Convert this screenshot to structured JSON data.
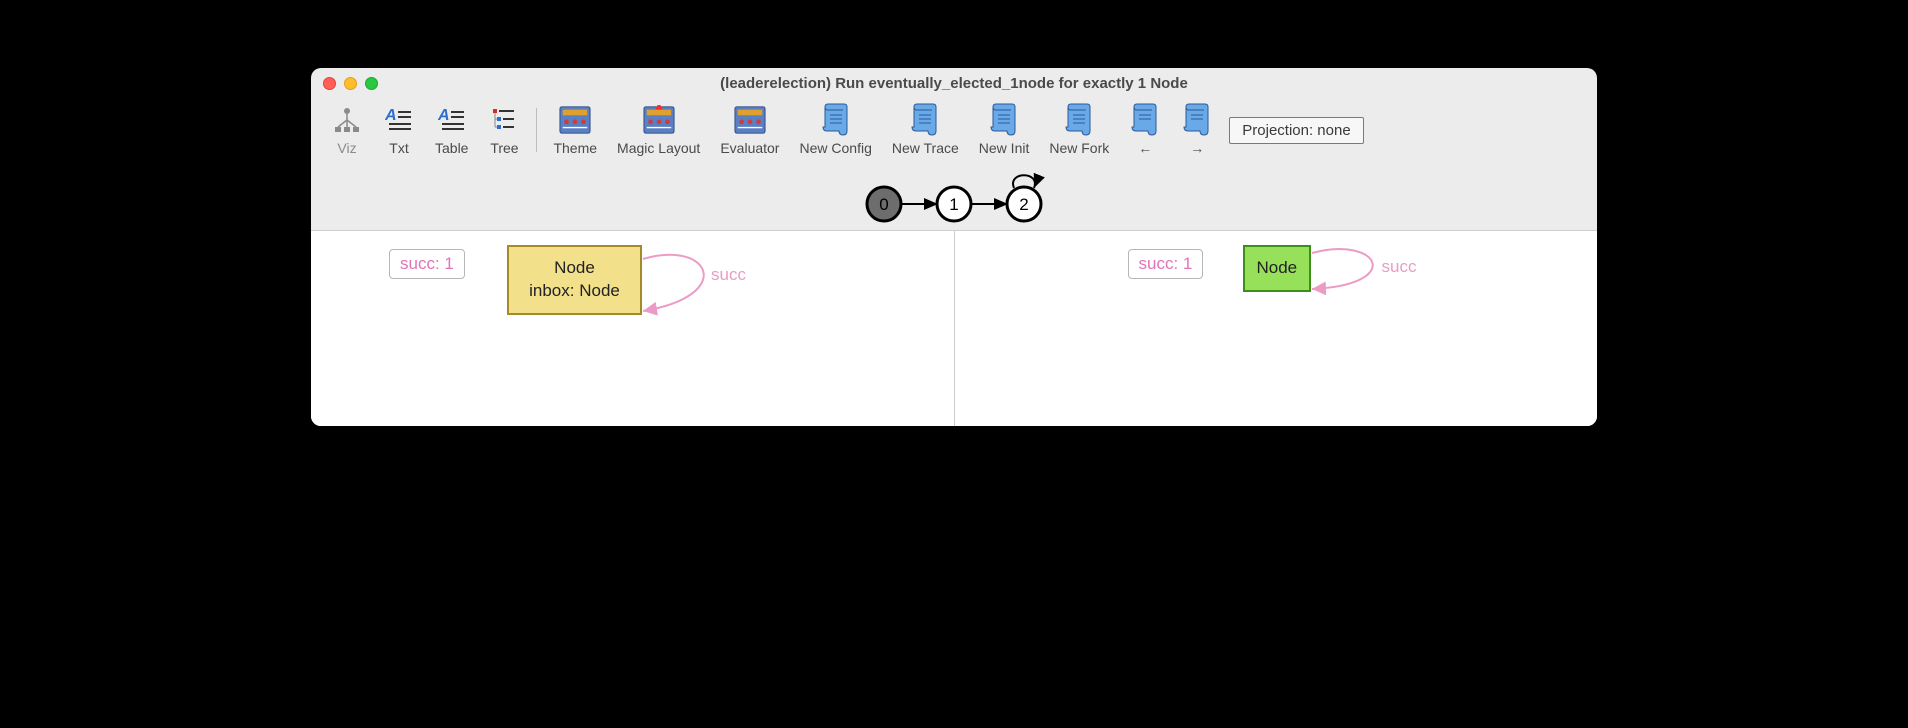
{
  "window": {
    "title": "(leaderelection) Run eventually_elected_1node for exactly 1 Node"
  },
  "toolbar": {
    "viz": "Viz",
    "txt": "Txt",
    "table": "Table",
    "tree": "Tree",
    "theme": "Theme",
    "magic": "Magic Layout",
    "evaluator": "Evaluator",
    "new_config": "New Config",
    "new_trace": "New Trace",
    "new_init": "New Init",
    "new_fork": "New Fork",
    "prev": "←",
    "next": "→",
    "projection": "Projection: none"
  },
  "trace": {
    "states": [
      "0",
      "1",
      "2"
    ],
    "selected": 0,
    "loop_back_from": 2,
    "loop_back_to": 2
  },
  "panes": {
    "left": {
      "succ_badge": "succ: 1",
      "node_line1": "Node",
      "node_line2": "inbox: Node",
      "edge_label": "succ"
    },
    "right": {
      "succ_badge": "succ: 1",
      "node_line1": "Node",
      "edge_label": "succ"
    }
  }
}
